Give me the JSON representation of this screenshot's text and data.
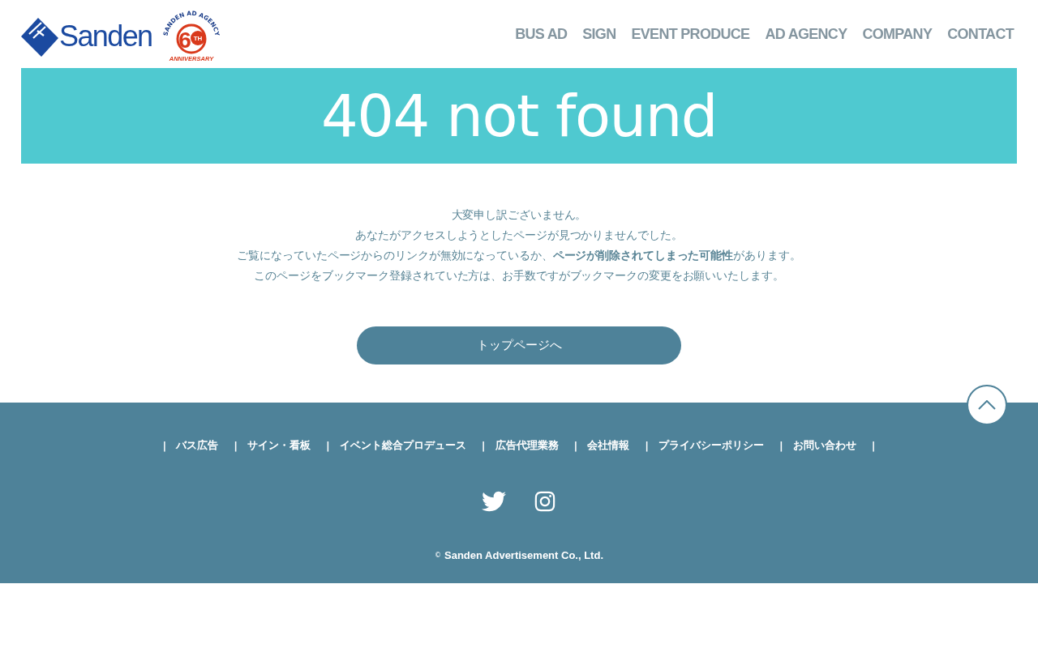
{
  "header": {
    "logo": {
      "wordmark": "Sanden"
    },
    "badge": {
      "arc_text": "SANDEN AD AGENCY",
      "number": "6",
      "ordinal": "TH",
      "caption": "ANNIVERSARY"
    },
    "nav": [
      {
        "label": "BUS AD"
      },
      {
        "label": "SIGN"
      },
      {
        "label": "EVENT PRODUCE"
      },
      {
        "label": "AD AGENCY"
      },
      {
        "label": "COMPANY"
      },
      {
        "label": "CONTACT"
      }
    ]
  },
  "banner": {
    "title": "404 not found"
  },
  "message": [
    "大変申し訳ございません。",
    "あなたがアクセスしようとしたページが見つかりませんでした。",
    "ご覧になっていたページからのリンクが無効になっているか、**ページが削除されてしまった可能性**があります。",
    "このページをブックマーク登録されていた方は、お手数ですがブックマークの変更をお願いいたします。"
  ],
  "top_button": {
    "label": "トップページへ"
  },
  "footer": {
    "nav": [
      {
        "separator": "|",
        "label": "バス広告"
      },
      {
        "separator": "|",
        "label": "サイン・看板"
      },
      {
        "separator": "|",
        "label": "イベント総合プロデュース"
      },
      {
        "separator": "|",
        "label": "広告代理業務"
      },
      {
        "separator": "|",
        "label": "会社情報"
      },
      {
        "separator": "|",
        "label": "プライバシーポリシー"
      },
      {
        "separator": "|",
        "label": "お問い合わせ"
      }
    ],
    "nav_end": "|",
    "social": [
      {
        "kind": "twitter"
      },
      {
        "kind": "instagram"
      }
    ],
    "copyright": {
      "mark": "©",
      "text": "Sanden Advertisement Co., Ltd."
    }
  }
}
